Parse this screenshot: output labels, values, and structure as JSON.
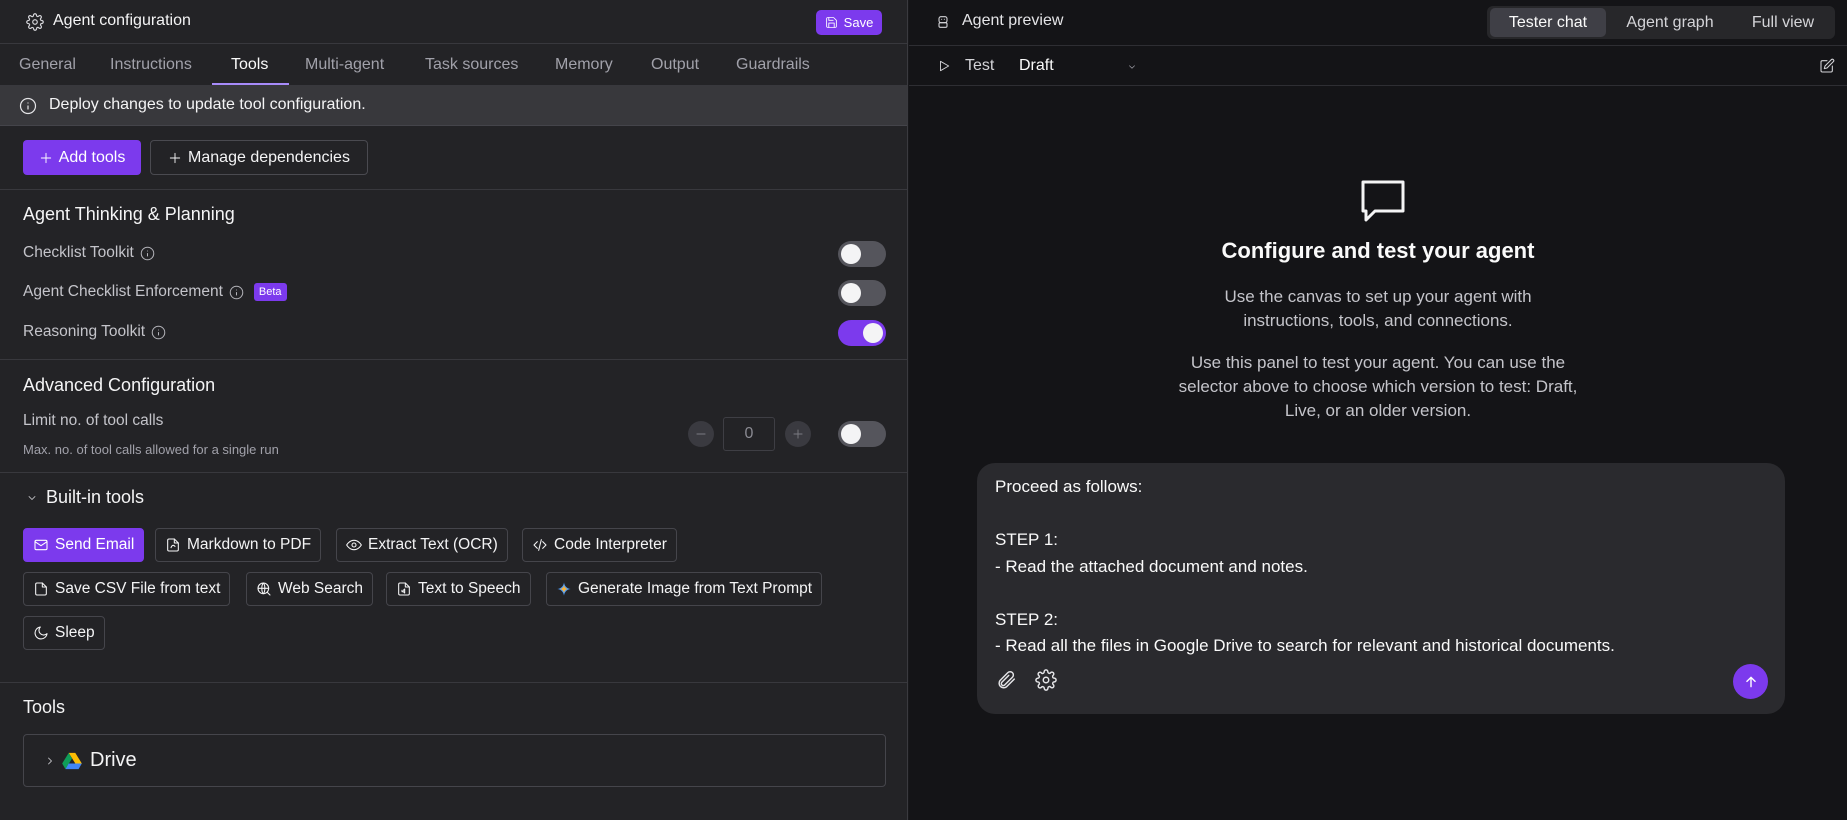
{
  "config": {
    "title": "Agent configuration",
    "save_label": "Save",
    "tabs": [
      "General",
      "Instructions",
      "Tools",
      "Multi-agent",
      "Task sources",
      "Memory",
      "Output",
      "Guardrails"
    ],
    "active_tab": "Tools",
    "banner": "Deploy changes to update tool configuration.",
    "add_tools_label": "Add tools",
    "manage_deps_label": "Manage dependencies",
    "thinking": {
      "title": "Agent Thinking & Planning",
      "checklist": {
        "label": "Checklist Toolkit",
        "enabled": false
      },
      "enforcement": {
        "label": "Agent Checklist Enforcement",
        "badge": "Beta",
        "enabled": false
      },
      "reasoning": {
        "label": "Reasoning Toolkit",
        "enabled": true
      }
    },
    "advanced": {
      "title": "Advanced Configuration",
      "limit_label": "Limit no. of tool calls",
      "limit_desc": "Max. no. of tool calls allowed for a single run",
      "limit_value": "0",
      "enabled": false
    },
    "builtin": {
      "title": "Built-in tools",
      "chips": [
        {
          "label": "Send Email",
          "icon": "mail-icon",
          "selected": true
        },
        {
          "label": "Markdown to PDF",
          "icon": "file-pdf-icon",
          "selected": false
        },
        {
          "label": "Extract Text (OCR)",
          "icon": "eye-icon",
          "selected": false
        },
        {
          "label": "Code Interpreter",
          "icon": "code-icon",
          "selected": false
        },
        {
          "label": "Save CSV File from text",
          "icon": "file-icon",
          "selected": false
        },
        {
          "label": "Web Search",
          "icon": "globe-search-icon",
          "selected": false
        },
        {
          "label": "Text to Speech",
          "icon": "file-audio-icon",
          "selected": false
        },
        {
          "label": "Generate Image from Text Prompt",
          "icon": "sparkle-icon",
          "selected": false
        },
        {
          "label": "Sleep",
          "icon": "moon-icon",
          "selected": false
        }
      ]
    },
    "tools": {
      "title": "Tools",
      "items": [
        {
          "name": "Drive",
          "icon": "google-drive-icon"
        }
      ]
    }
  },
  "preview": {
    "title": "Agent preview",
    "views": [
      "Tester chat",
      "Agent graph",
      "Full view"
    ],
    "active_view": "Tester chat",
    "test_label": "Test",
    "version": "Draft",
    "hero_title": "Configure and test your agent",
    "hero_p1": "Use the canvas to set up your agent with instructions, tools, and connections.",
    "hero_p2": "Use this panel to test your agent. You can use the selector above to choose which version to test: Draft, Live, or an older version.",
    "message": "Proceed as follows:\n\nSTEP 1:\n- Read the attached document and notes.\n\nSTEP 2:\n- Read all the files in Google Drive to search for relevant and historical documents."
  },
  "colors": {
    "accent": "#7c3aed",
    "bg_left": "#232326",
    "bg_right": "#141417"
  }
}
